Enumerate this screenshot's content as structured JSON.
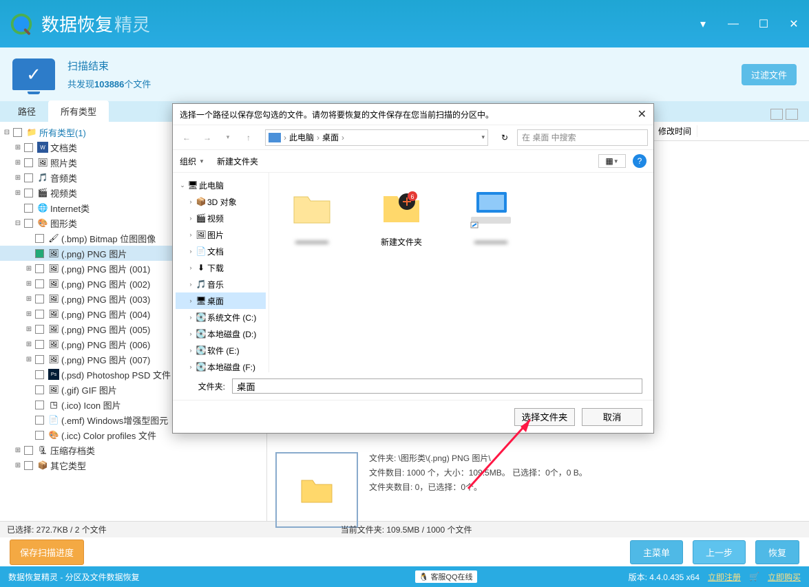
{
  "app": {
    "title1": "数据恢复",
    "title2": "精灵"
  },
  "scan": {
    "title": "扫描结束",
    "found_prefix": "共发现",
    "found_count": "103886",
    "found_suffix": "个文件",
    "filter_btn": "过滤文件"
  },
  "tabs": {
    "path": "路径",
    "types": "所有类型"
  },
  "tree": {
    "root": "所有类型(1)",
    "docs": "文档类",
    "photos": "照片类",
    "audio": "音频类",
    "video": "视频类",
    "internet": "Internet类",
    "graphics": "图形类",
    "bmp": "(.bmp) Bitmap 位图图像",
    "png": "(.png) PNG 图片",
    "png1": "(.png) PNG 图片 (001)",
    "png2": "(.png) PNG 图片 (002)",
    "png3": "(.png) PNG 图片 (003)",
    "png4": "(.png) PNG 图片 (004)",
    "png5": "(.png) PNG 图片 (005)",
    "png6": "(.png) PNG 图片 (006)",
    "png7": "(.png) PNG 图片 (007)",
    "psd": "(.psd) Photoshop PSD 文件",
    "gif": "(.gif) GIF 图片",
    "ico": "(.ico) Icon 图片",
    "emf": "(.emf) Windows增强型图元",
    "icc": "(.icc) Color profiles 文件",
    "archive": "压缩存档类",
    "other": "其它类型"
  },
  "content": {
    "col_mtime": "修改时间",
    "folder_path": "文件夹: \\图形类\\(.png) PNG 图片\\",
    "file_stats": "文件数目: 1000 个，大小：109.5MB。",
    "sel_stats": "已选择：0个，0 B。",
    "folder_stats": "文件夹数目: 0，已选择：0个。"
  },
  "status": {
    "selected": "已选择: 272.7KB / 2 个文件",
    "current": "当前文件夹: 109.5MB / 1000 个文件",
    "save_progress": "保存扫描进度",
    "main_menu": "主菜单",
    "prev": "上一步",
    "recover": "恢复"
  },
  "footer": {
    "app": "数据恢复精灵 - 分区及文件数据恢复",
    "qq": "客服QQ在线",
    "version": "版本: 4.4.0.435 x64",
    "register": "立即注册",
    "buy": "立即购买"
  },
  "dialog": {
    "title": "选择一个路径以保存您勾选的文件。请勿将要恢复的文件保存在您当前扫描的分区中。",
    "breadcrumb": {
      "pc": "此电脑",
      "desktop": "桌面"
    },
    "search_placeholder": "在 桌面 中搜索",
    "organize": "组织",
    "new_folder": "新建文件夹",
    "tree": {
      "pc": "此电脑",
      "3d": "3D 对象",
      "video": "视频",
      "pictures": "图片",
      "docs": "文档",
      "downloads": "下载",
      "music": "音乐",
      "desktop": "桌面",
      "sysc": "系统文件 (C:)",
      "diskd": "本地磁盘 (D:)",
      "softe": "软件 (E:)",
      "diskf": "本地磁盘 (F:)"
    },
    "items": {
      "new_folder": "新建文件夹"
    },
    "folder_label": "文件夹:",
    "folder_value": "桌面",
    "select_btn": "选择文件夹",
    "cancel_btn": "取消"
  }
}
